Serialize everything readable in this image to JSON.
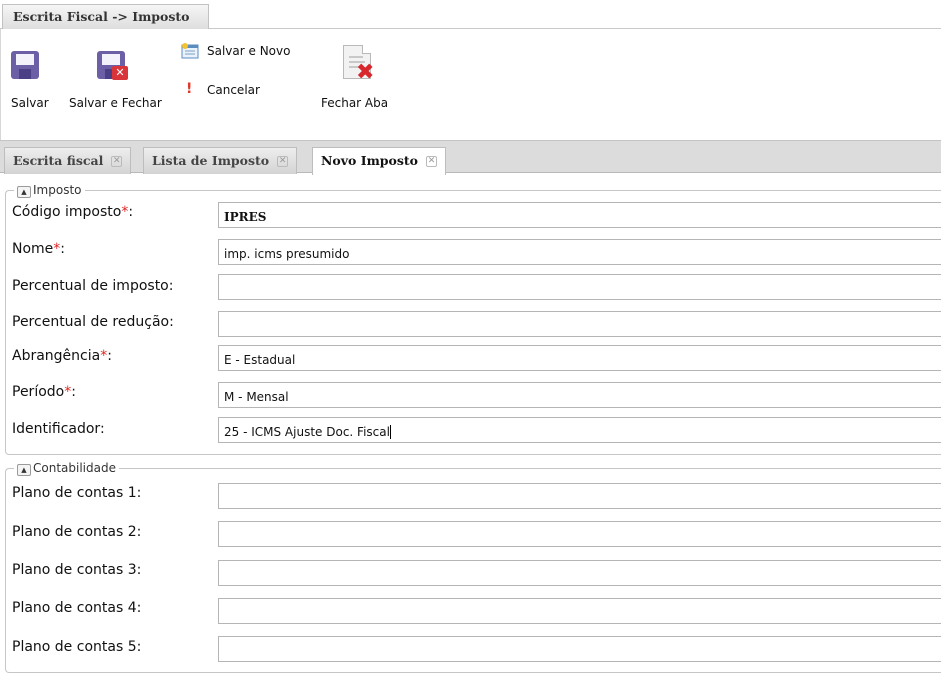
{
  "window_tab": {
    "label": "Escrita Fiscal -> Imposto"
  },
  "toolbar": {
    "save_label": "Salvar",
    "save_close_label": "Salvar e Fechar",
    "save_new_label": "Salvar e Novo",
    "cancel_label": "Cancelar",
    "close_tab_label": "Fechar Aba",
    "icons": [
      "floppy-disk-icon",
      "floppy-disk-close-icon",
      "new-document-icon",
      "exclamation-icon",
      "close-document-icon"
    ],
    "accent_color": "#6d5fa6",
    "danger_color": "#d9343a"
  },
  "tabs": [
    {
      "label": "Escrita fiscal",
      "active": false
    },
    {
      "label": "Lista de Imposto",
      "active": false
    },
    {
      "label": "Novo Imposto",
      "active": true
    }
  ],
  "imposto": {
    "legend": "Imposto",
    "required_mark": "*",
    "fields": {
      "codigo": {
        "label": "Código imposto",
        "required": true,
        "value": "IPRES"
      },
      "nome": {
        "label": "Nome",
        "required": true,
        "value": "imp. icms presumido"
      },
      "percentual_imposto": {
        "label": "Percentual de imposto:",
        "required": false,
        "value": ""
      },
      "percentual_reducao": {
        "label": "Percentual de redução:",
        "required": false,
        "value": ""
      },
      "abrangencia": {
        "label": "Abrangência",
        "required": true,
        "value": "E - Estadual"
      },
      "periodo": {
        "label": "Período",
        "required": true,
        "value": "M - Mensal"
      },
      "identificador": {
        "label": "Identificador:",
        "required": false,
        "value": "25 - ICMS Ajuste Doc. Fiscal"
      }
    }
  },
  "contabilidade": {
    "legend": "Contabilidade",
    "fields": [
      {
        "label": "Plano de contas 1:",
        "value": ""
      },
      {
        "label": "Plano de contas 2:",
        "value": ""
      },
      {
        "label": "Plano de contas 3:",
        "value": ""
      },
      {
        "label": "Plano de contas 4:",
        "value": ""
      },
      {
        "label": "Plano de contas 5:",
        "value": ""
      }
    ]
  },
  "colon": ":"
}
